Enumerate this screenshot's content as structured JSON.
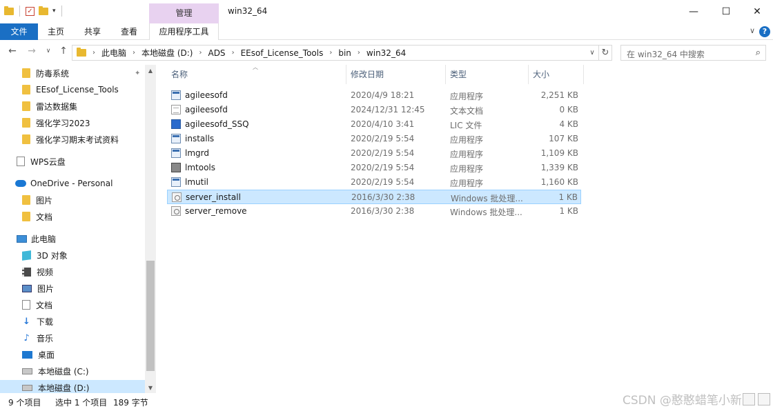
{
  "window": {
    "title": "win32_64",
    "manage_tab": "管理",
    "minimize": "—",
    "maximize": "☐",
    "close": "✕"
  },
  "ribbon": {
    "tabs": [
      "文件",
      "主页",
      "共享",
      "查看",
      "应用程序工具"
    ]
  },
  "address": {
    "crumbs": [
      "此电脑",
      "本地磁盘 (D:)",
      "ADS",
      "EEsof_License_Tools",
      "bin",
      "win32_64"
    ],
    "search_placeholder": "在 win32_64 中搜索"
  },
  "nav_pane": {
    "quick_access": [
      "防毒系统",
      "EEsof_License_Tools",
      "雷达数据集",
      "强化学习2023",
      "强化学习期末考试资料"
    ],
    "wps": "WPS云盘",
    "onedrive": "OneDrive - Personal",
    "onedrive_items": [
      "图片",
      "文档"
    ],
    "this_pc": "此电脑",
    "pc_items": [
      "3D 对象",
      "视频",
      "图片",
      "文档",
      "下载",
      "音乐",
      "桌面",
      "本地磁盘 (C:)",
      "本地磁盘 (D:)"
    ]
  },
  "columns": {
    "name": "名称",
    "date": "修改日期",
    "type": "类型",
    "size": "大小"
  },
  "files": [
    {
      "name": "agileesofd",
      "date": "2020/4/9 18:21",
      "type": "应用程序",
      "size": "2,251 KB",
      "icon": "exe"
    },
    {
      "name": "agileesofd",
      "date": "2024/12/31 12:45",
      "type": "文本文档",
      "size": "0 KB",
      "icon": "txt"
    },
    {
      "name": "agileesofd_SSQ",
      "date": "2020/4/10 3:41",
      "type": "LIC 文件",
      "size": "4 KB",
      "icon": "lic"
    },
    {
      "name": "installs",
      "date": "2020/2/19 5:54",
      "type": "应用程序",
      "size": "107 KB",
      "icon": "exe"
    },
    {
      "name": "lmgrd",
      "date": "2020/2/19 5:54",
      "type": "应用程序",
      "size": "1,109 KB",
      "icon": "exe"
    },
    {
      "name": "lmtools",
      "date": "2020/2/19 5:54",
      "type": "应用程序",
      "size": "1,339 KB",
      "icon": "tool"
    },
    {
      "name": "lmutil",
      "date": "2020/2/19 5:54",
      "type": "应用程序",
      "size": "1,160 KB",
      "icon": "exe"
    },
    {
      "name": "server_install",
      "date": "2016/3/30 2:38",
      "type": "Windows 批处理...",
      "size": "1 KB",
      "icon": "bat"
    },
    {
      "name": "server_remove",
      "date": "2016/3/30 2:38",
      "type": "Windows 批处理...",
      "size": "1 KB",
      "icon": "bat"
    }
  ],
  "status": {
    "count": "9 个项目",
    "selected": "选中 1 个项目",
    "bytes": "189 字节"
  },
  "watermark": "CSDN @憨憨蜡笔小新",
  "colors": {
    "accent": "#1a6fc4",
    "selection": "#cce8ff",
    "manage": "#e8d2f0"
  }
}
